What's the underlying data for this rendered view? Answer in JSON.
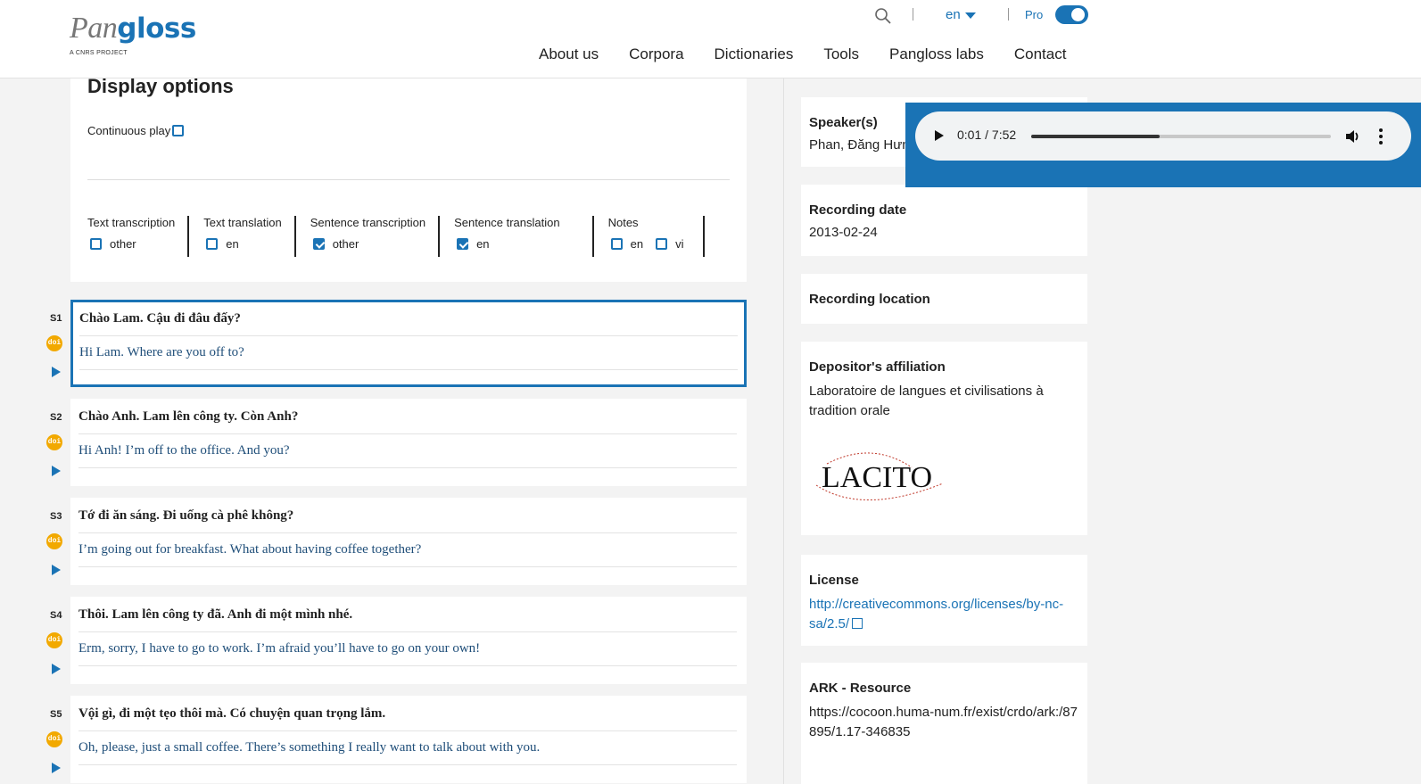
{
  "header": {
    "logo_pan": "Pan",
    "logo_gloss": "gloss",
    "logo_sub": "A CNRS PROJECT",
    "lang": "en",
    "pro_label": "Pro",
    "nav": [
      "About us",
      "Corpora",
      "Dictionaries",
      "Tools",
      "Pangloss labs",
      "Contact"
    ]
  },
  "display_options": {
    "title": "Display options",
    "continuous_play": "Continuous play",
    "groups": [
      {
        "title": "Text transcription",
        "options": [
          {
            "label": "other",
            "checked": false
          }
        ]
      },
      {
        "title": "Text translation",
        "options": [
          {
            "label": "en",
            "checked": false
          }
        ]
      },
      {
        "title": "Sentence transcription",
        "options": [
          {
            "label": "other",
            "checked": true
          }
        ]
      },
      {
        "title": "Sentence translation",
        "options": [
          {
            "label": "en",
            "checked": true
          }
        ]
      },
      {
        "title": "Notes",
        "options": [
          {
            "label": "en",
            "checked": false
          },
          {
            "label": "vi",
            "checked": false
          }
        ]
      }
    ]
  },
  "doi_label": "doi",
  "sentences": [
    {
      "id": "S1",
      "transcription": "Chào Lam. Cậu đi đâu đấy?",
      "translation": "Hi Lam. Where are you off to?"
    },
    {
      "id": "S2",
      "transcription": "Chào Anh. Lam lên công ty. Còn Anh?",
      "translation": "Hi Anh! I’m off to the office. And you?"
    },
    {
      "id": "S3",
      "transcription": "Tớ đi ăn sáng. Đi uống cà phê không?",
      "translation": "I’m going out for breakfast. What about having coffee together?"
    },
    {
      "id": "S4",
      "transcription": "Thôi. Lam lên công ty đã. Anh đi một mình nhé.",
      "translation": "Erm, sorry, I have to go to work. I’m afraid you’ll have to go on your own!"
    },
    {
      "id": "S5",
      "transcription": "Vội gì, đi một tẹo thôi mà. Có chuyện quan trọng lắm.",
      "translation": "Oh, please, just a small coffee. There’s something I really want to talk about with you."
    }
  ],
  "sidebar": {
    "speakers_label": "Speaker(s)",
    "speakers_value": "Phan, Đăng Hưng",
    "recording_date_label": "Recording date",
    "recording_date_value": "2013-02-24",
    "recording_location_label": "Recording location",
    "affiliation_label": "Depositor's affiliation",
    "affiliation_value": "Laboratoire de langues et civilisations à tradition orale",
    "lacito_logo_text": "LACITO",
    "license_label": "License",
    "license_value": "http://creativecommons.org/licenses/by-nc-sa/2.5/",
    "ark_label": "ARK - Resource",
    "ark_value": "https://cocoon.huma-num.fr/exist/crdo/ark:/87895/1.17-346835"
  },
  "audio": {
    "time": "0:01 / 7:52",
    "progress": 0.43
  },
  "colors": {
    "accent": "#1a73b5",
    "doi": "#f2a900",
    "translation": "#1f4e79"
  }
}
